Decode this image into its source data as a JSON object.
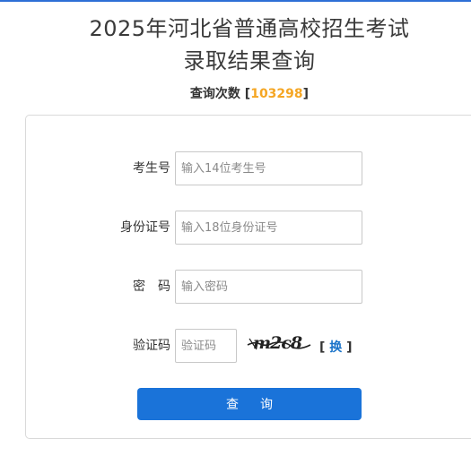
{
  "header": {
    "title_line1": "2025年河北省普通高校招生考试",
    "title_line2": "录取结果查询",
    "count_label": "查询次数",
    "count_open": "[",
    "count_value": "103298",
    "count_close": "]"
  },
  "form": {
    "exam_no": {
      "label": "考生号",
      "placeholder": "输入14位考生号",
      "value": ""
    },
    "id_no": {
      "label": "身份证号",
      "placeholder": "输入18位身份证号",
      "value": ""
    },
    "password": {
      "label": "密　码",
      "placeholder": "输入密码",
      "value": ""
    },
    "captcha": {
      "label": "验证码",
      "placeholder": "验证码",
      "value": "",
      "image_text": "m2c8"
    },
    "refresh": {
      "open": "[",
      "label": "换",
      "close": "]"
    },
    "submit_label": "查询"
  },
  "colors": {
    "accent": "#1a73d9",
    "count": "#f5a623",
    "refresh_link": "#1a73c9"
  }
}
